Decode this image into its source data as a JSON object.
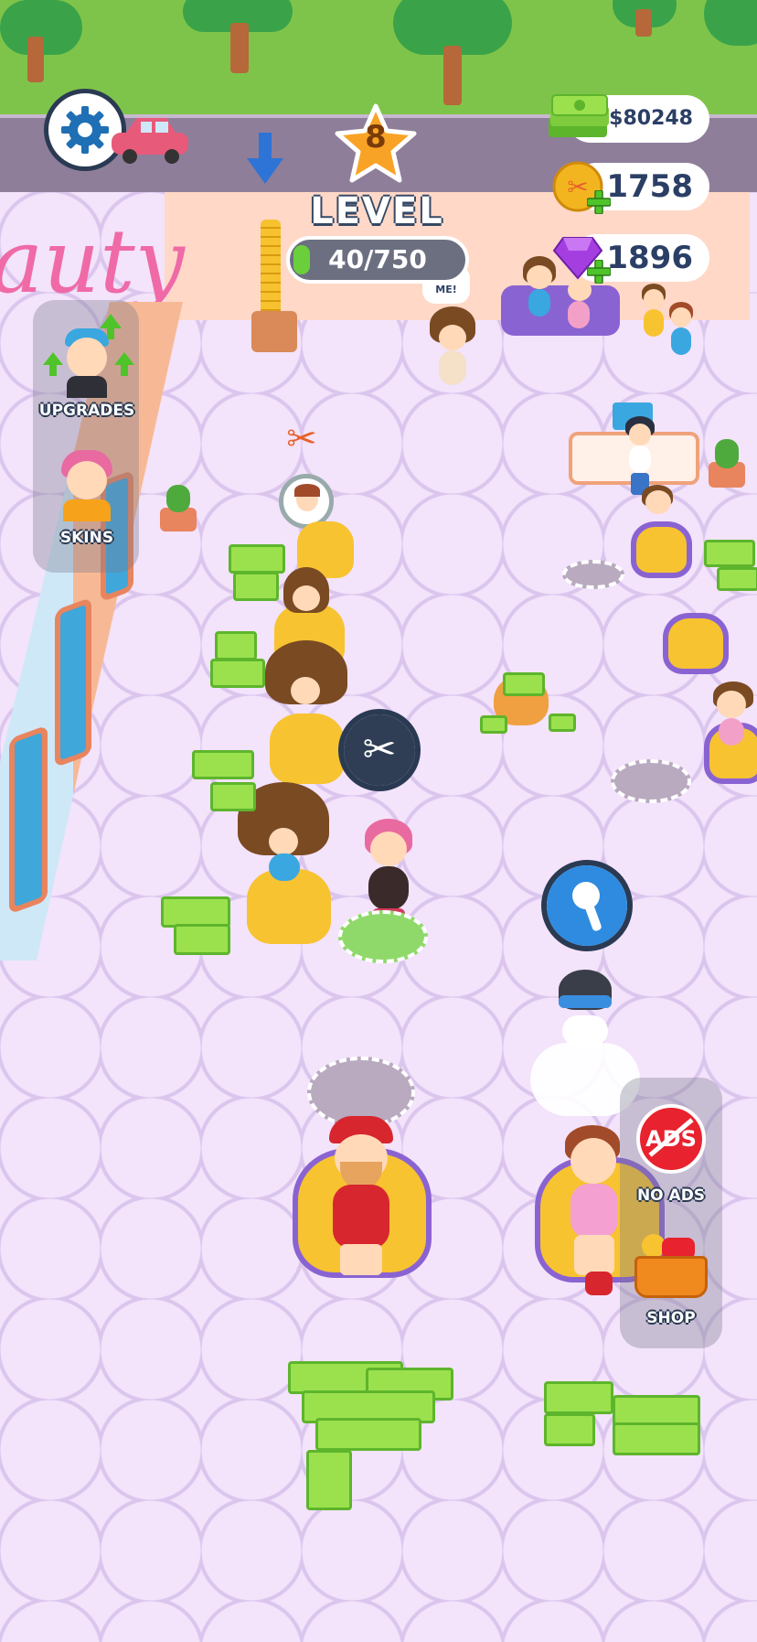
{
  "hud": {
    "level_number": "8",
    "level_label": "LEVEL",
    "level_progress_text": "40/750",
    "level_progress_fraction": 0.053,
    "cash": "$80248",
    "coins": "1758",
    "gems": "1896"
  },
  "side_menu": {
    "upgrades_label": "UPGRADES",
    "skins_label": "SKINS"
  },
  "right_menu": {
    "no_ads_label": "NO ADS",
    "ads_icon_text": "ADS",
    "shop_label": "SHOP"
  },
  "world": {
    "help_bubble": "HELP ME!",
    "sign_text": "auty"
  },
  "icons": {
    "settings": "gear-icon",
    "scissors": "scissors-icon",
    "shower": "shower-icon",
    "arrow": "arrow-down-icon"
  },
  "colors": {
    "accent_dark": "#2b3f66",
    "cash_green": "#9be14e",
    "level_star": "#f9a326",
    "floor": "#f3e3fb"
  }
}
